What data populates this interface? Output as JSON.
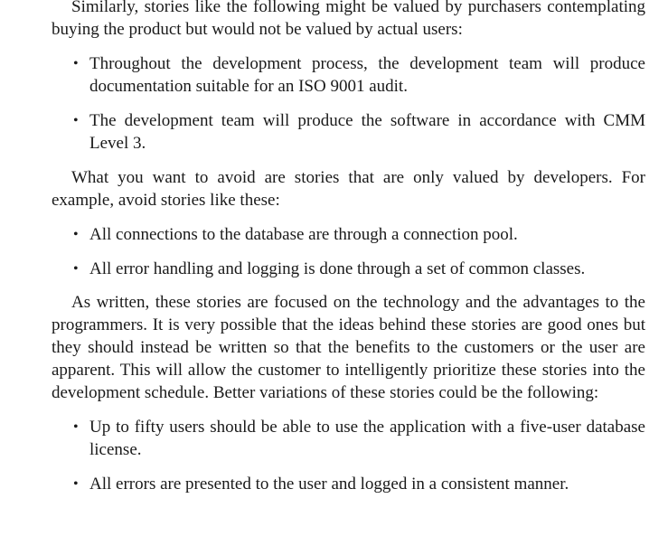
{
  "paragraphs": {
    "p1": "Similarly, stories like the following might be valued by purchasers contemplating buying the product but would not be valued by actual users:",
    "p2": "What you want to avoid are stories that are only valued by developers. For example, avoid stories like these:",
    "p3": "As written, these stories are focused on the technology and the advantages to the programmers. It is very possible that the ideas behind these stories are good ones but they should instead be written so that the benefits to the customers or the user are apparent. This will allow the customer to intelligently prioritize these stories into the development schedule. Better variations of these stories could be the following:"
  },
  "lists": {
    "purchaser_stories": [
      "Throughout the development process, the development team will produce documentation suitable for an ISO 9001 audit.",
      "The development team will produce the software in accordance with CMM Level 3."
    ],
    "developer_stories": [
      "All connections to the database are through a connection pool.",
      "All error handling and logging is done through a set of common classes."
    ],
    "better_stories": [
      "Up to fifty users should be able to use the application with a five-user database license.",
      "All errors are presented to the user and logged in a consistent manner."
    ]
  },
  "bullet_glyph": "•"
}
